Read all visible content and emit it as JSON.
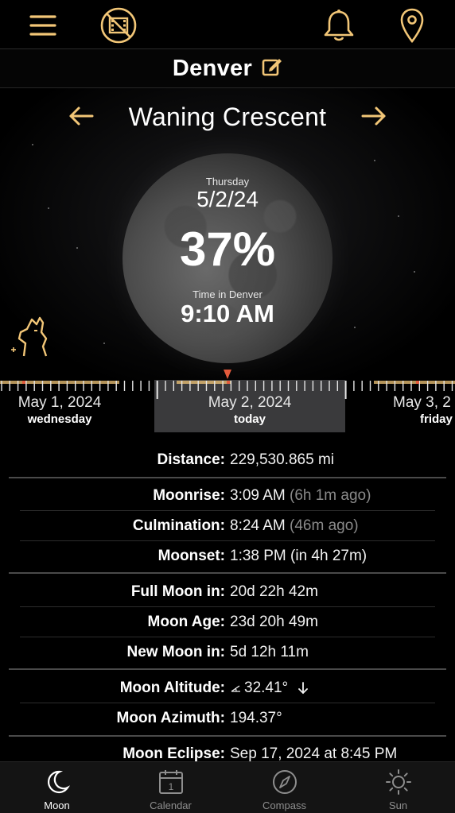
{
  "colors": {
    "accent": "#F2C677",
    "tick_red": "#E25A3C",
    "panel_gray": "#3A3A3C"
  },
  "topbar": {
    "icons": [
      "hamburger-menu-icon",
      "no-video-icon",
      "bell-icon",
      "map-pin-icon"
    ]
  },
  "location": {
    "city": "Denver",
    "edit_icon": "edit-icon"
  },
  "phase": {
    "name": "Waning Crescent",
    "prev_icon": "arrow-left-icon",
    "next_icon": "arrow-right-icon"
  },
  "moon_face": {
    "weekday": "Thursday",
    "date": "5/2/24",
    "illumination": "37%",
    "time_label": "Time in Denver",
    "time": "9:10 AM"
  },
  "timeline": {
    "days": [
      {
        "date": "May 1, 2024",
        "sub": "wednesday"
      },
      {
        "date": "May 2, 2024",
        "sub": "today"
      },
      {
        "date": "May 3, 2",
        "sub": "friday"
      }
    ]
  },
  "details": {
    "distance": {
      "label": "Distance:",
      "value": "229,530.865 mi"
    },
    "moonrise": {
      "label": "Moonrise:",
      "value": "3:09 AM",
      "note": "(6h 1m ago)"
    },
    "culmination": {
      "label": "Culmination:",
      "value": "8:24 AM",
      "note": "(46m ago)"
    },
    "moonset": {
      "label": "Moonset:",
      "value": "1:38 PM (in 4h 27m)"
    },
    "full_moon": {
      "label": "Full Moon in:",
      "value": "20d 22h 42m"
    },
    "moon_age": {
      "label": "Moon Age:",
      "value": "23d 20h 49m"
    },
    "new_moon": {
      "label": "New Moon in:",
      "value": "5d 12h 11m"
    },
    "altitude": {
      "label": "Moon Altitude:",
      "value": "32.41°"
    },
    "azimuth": {
      "label": "Moon Azimuth:",
      "value": "194.37°"
    },
    "eclipse": {
      "label": "Moon Eclipse:",
      "value": "Sep 17, 2024 at 8:45 PM"
    }
  },
  "tabs": [
    {
      "label": "Moon",
      "icon": "moon-icon",
      "active": true
    },
    {
      "label": "Calendar",
      "icon": "calendar-icon",
      "active": false
    },
    {
      "label": "Compass",
      "icon": "compass-icon",
      "active": false
    },
    {
      "label": "Sun",
      "icon": "sun-icon",
      "active": false
    }
  ],
  "calendar_icon_day": "1"
}
